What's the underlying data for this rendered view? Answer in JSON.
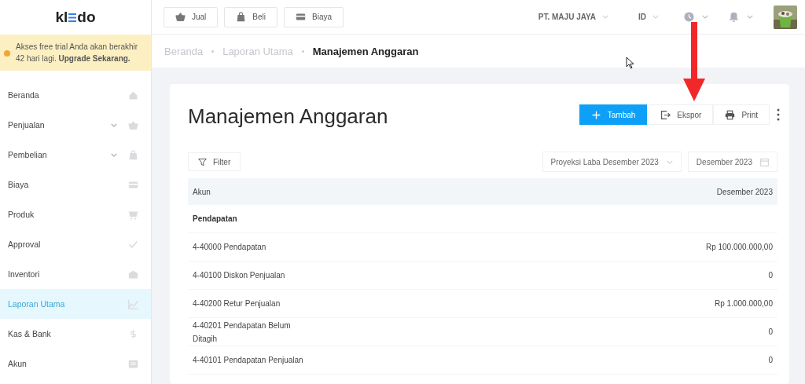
{
  "logo": {
    "before": "kl",
    "after": "do"
  },
  "trial_notice": {
    "text": "Akses free trial Anda akan berakhir 42 hari lagi.",
    "link": "Upgrade Sekarang."
  },
  "sidebar": {
    "items": [
      {
        "label": "Beranda",
        "expandable": false,
        "selected": false
      },
      {
        "label": "Penjualan",
        "expandable": true,
        "selected": false
      },
      {
        "label": "Pembelian",
        "expandable": true,
        "selected": false
      },
      {
        "label": "Biaya",
        "expandable": false,
        "selected": false
      },
      {
        "label": "Produk",
        "expandable": false,
        "selected": false
      },
      {
        "label": "Approval",
        "expandable": false,
        "selected": false
      },
      {
        "label": "Inventori",
        "expandable": false,
        "selected": false
      },
      {
        "label": "Laporan Utama",
        "expandable": false,
        "selected": true
      },
      {
        "label": "Kas & Bank",
        "expandable": false,
        "selected": false
      },
      {
        "label": "Akun",
        "expandable": false,
        "selected": false
      }
    ]
  },
  "top_bar": {
    "quick_buttons": [
      {
        "label": "Jual"
      },
      {
        "label": "Beli"
      },
      {
        "label": "Biaya"
      }
    ],
    "company": "PT. MAJU JAYA",
    "language": "ID"
  },
  "breadcrumb": [
    {
      "label": "Beranda",
      "current": false
    },
    {
      "label": "Laporan Utama",
      "current": false
    },
    {
      "label": "Manajemen Anggaran",
      "current": true
    }
  ],
  "page": {
    "title": "Manajemen Anggaran",
    "actions": [
      {
        "label": "Tambah",
        "kind": "primary"
      },
      {
        "label": "Ekspor",
        "kind": "default"
      },
      {
        "label": "Print",
        "kind": "default"
      }
    ],
    "filter_button": "Filter",
    "budget_select": "Proyeksi Laba Desember 2023",
    "period_field": "Desember 2023"
  },
  "table": {
    "columns": [
      "Akun",
      "Desember 2023"
    ],
    "rows": [
      {
        "kind": "group",
        "account": "Pendapatan"
      },
      {
        "kind": "line",
        "account": "4-40000 Pendapatan",
        "value": "Rp 100.000.000,00"
      },
      {
        "kind": "line",
        "account": "4-40100 Diskon Penjualan",
        "value": "0"
      },
      {
        "kind": "line",
        "account": "4-40200 Retur Penjualan",
        "value": "Rp 1.000.000,00"
      },
      {
        "kind": "line",
        "account": "4-40201 Pendapatan Belum Ditagih",
        "value": "0"
      },
      {
        "kind": "line",
        "account": "4-40101 Pendapatan Penjualan",
        "value": "0"
      }
    ]
  }
}
